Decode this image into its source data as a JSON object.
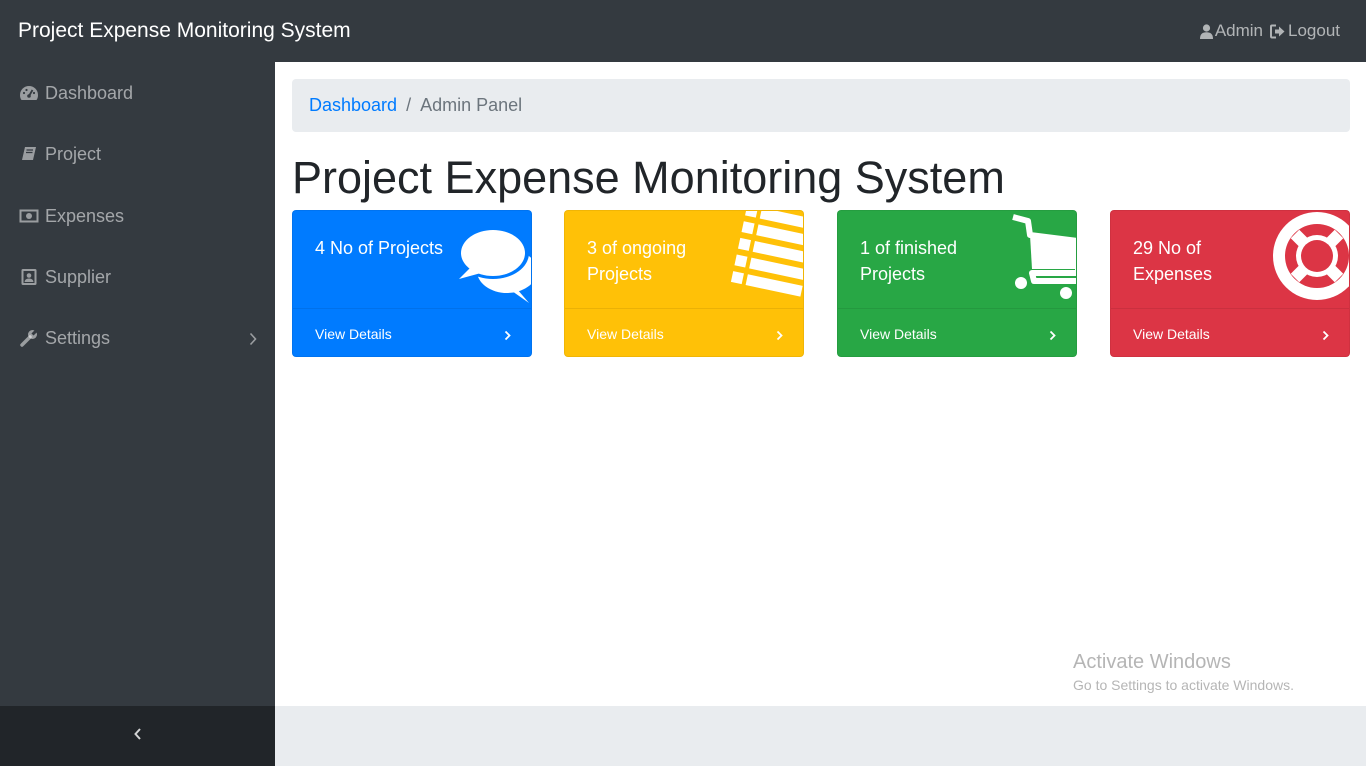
{
  "app": {
    "brand": "Project Expense Monitoring System",
    "user_label": "Admin",
    "logout_label": "Logout"
  },
  "sidebar": {
    "items": [
      {
        "label": "Dashboard",
        "icon": "tachometer-icon"
      },
      {
        "label": "Project",
        "icon": "book-icon"
      },
      {
        "label": "Expenses",
        "icon": "money-icon"
      },
      {
        "label": "Supplier",
        "icon": "id-badge-icon"
      },
      {
        "label": "Settings",
        "icon": "wrench-icon",
        "has_submenu": true
      }
    ]
  },
  "breadcrumb": {
    "link": "Dashboard",
    "separator": "/",
    "active": "Admin Panel"
  },
  "main": {
    "title": "Project Expense Monitoring System"
  },
  "cards": [
    {
      "label": "4 No of Projects",
      "footer": "View Details",
      "color": "#007bff",
      "icon": "comments-icon"
    },
    {
      "label": "3 of ongoing Projects",
      "footer": "View Details",
      "color": "#ffc107",
      "icon": "list-icon"
    },
    {
      "label": "1 of finished Projects",
      "footer": "View Details",
      "color": "#28a745",
      "icon": "shopping-cart-icon"
    },
    {
      "label": "29 No of Expenses",
      "footer": "View Details",
      "color": "#dc3545",
      "icon": "life-ring-icon"
    }
  ],
  "watermark": {
    "line1": "Activate Windows",
    "line2": "Go to Settings to activate Windows."
  }
}
